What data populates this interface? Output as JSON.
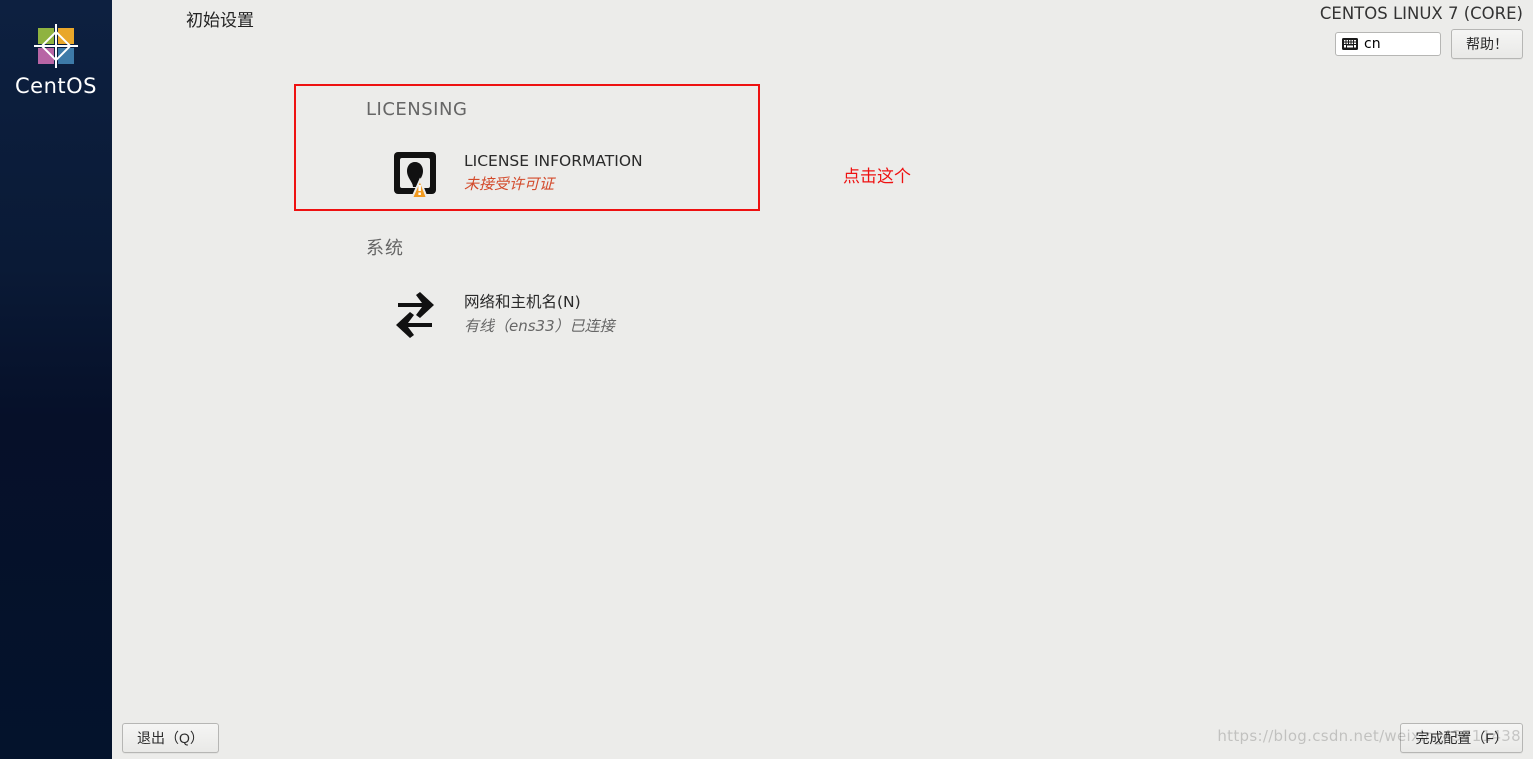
{
  "sidebar": {
    "logo_text": "CentOS"
  },
  "topbar": {
    "page_title": "初始设置",
    "os_title": "CENTOS LINUX 7 (CORE)",
    "lang_code": "cn",
    "help_label": "帮助！"
  },
  "sections": {
    "licensing": {
      "heading": "LICENSING",
      "spoke": {
        "title": "LICENSE INFORMATION",
        "status": "未接受许可证"
      }
    },
    "system": {
      "heading": "系统",
      "spoke": {
        "title": "网络和主机名(N)",
        "status": "有线（ens33）已连接"
      }
    }
  },
  "annotation": {
    "text": "点击这个"
  },
  "bottombar": {
    "quit_label": "退出（Q）",
    "finish_label": "完成配置（F）"
  },
  "watermark": "https://blog.csdn.net/weixin_43711438"
}
